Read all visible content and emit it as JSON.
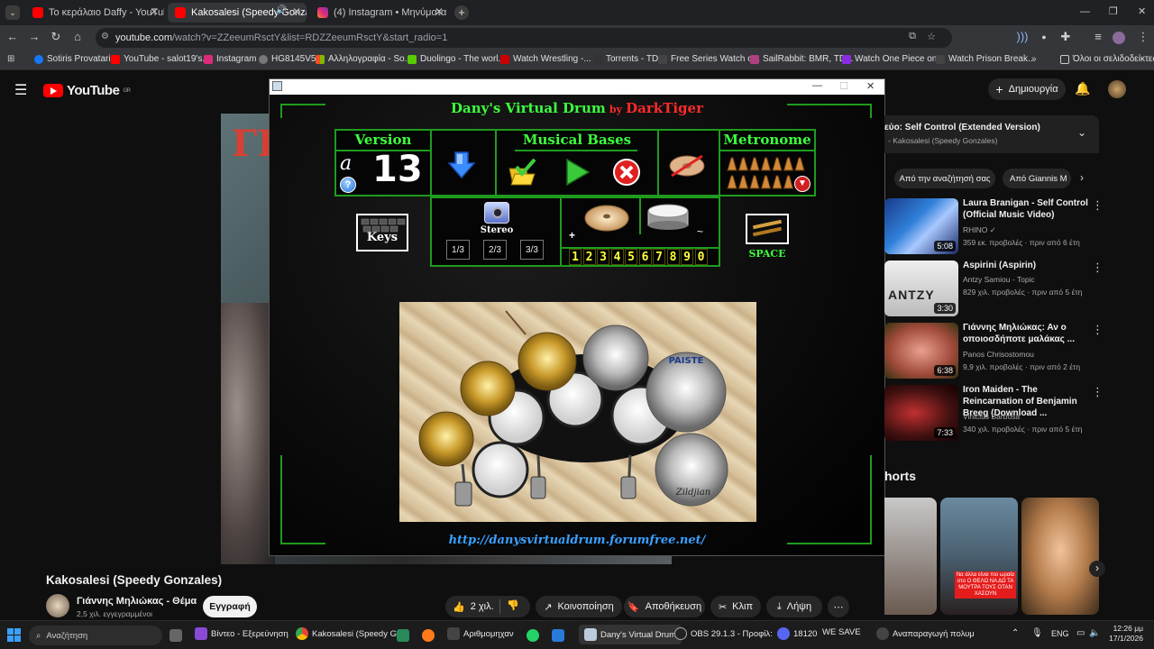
{
  "tabs": [
    {
      "label": "Το κεράλαιο Daffy - YouTube"
    },
    {
      "label": "Kakosalesi (Speedy Gonzales"
    },
    {
      "label": "(4) Instagram • Μηνύματα"
    }
  ],
  "address": {
    "host": "youtube.com",
    "path": "/watch?v=ZZeeumRsctY&list=RDZZeeumRsctY&start_radio=1"
  },
  "bookmarks": [
    "Sotiris Provataris",
    "YouTube - salot19's...",
    "Instagram",
    "HG8145V5",
    "Αλληλογραφία - So...",
    "Duolingo - The worl...",
    "Watch Wrestling -...",
    "Torrents - TD",
    "Free Series Watch o...",
    "SailRabbit: BMR, TD...",
    "Watch One Piece on...",
    "Watch Prison Break...",
    "Όλοι οι σελιδοδείκτες"
  ],
  "yt": {
    "logo": "YouTube",
    "region": "GR",
    "create_label": "Δημιουργία",
    "playlist_now": "εύο: Self Control (Extended Version)",
    "playlist_channel": "- Kakosalesi (Speedy Gonzales)",
    "chips": [
      "Από την αναζήτησή σας",
      "Από Giannis M"
    ],
    "video_title": "Kakosalesi (Speedy Gonzales)",
    "channel": "Γιάννης Μηλιώκας - Θέμα",
    "subs": "2,5 χιλ. εγγεγραμμένοι",
    "subscribe": "Εγγραφή",
    "likes": "2 χιλ.",
    "actions": [
      "Κοινοποίηση",
      "Αποθήκευση",
      "Κλιπ",
      "Λήψη"
    ],
    "shorts_label": "horts",
    "recommended": [
      {
        "title": "Laura Branigan - Self Control (Official Music Video)",
        "channel": "RHINO",
        "meta": "359 εκ. προβολές · πριν από 6 έτη",
        "duration": "5:08"
      },
      {
        "title": "Aspirini (Aspirin)",
        "channel": "Antzy Samiou - Topic",
        "meta": "829 χιλ. προβολές · πριν από 5 έτη",
        "duration": "3:30"
      },
      {
        "title": "Γιάννης Μηλιώκας: Αν ο οποιοσδήποτε μαλάκας ...",
        "channel": "Panos Chrisostomou",
        "meta": "9,9 χιλ. προβολές · πριν από 2 έτη",
        "duration": "6:38"
      },
      {
        "title": "Iron Maiden - The Reincarnation of Benjamin Breeg (Download ...",
        "channel": "Vinicius Barbosa",
        "meta": "340 χιλ. προβολές · πριν από 5 έτη",
        "duration": "7:33"
      }
    ],
    "thumb_text": "ANTZY",
    "short_caption": "Να άλλα είναι πιο ωραία στο Ο ΘΕΛΩ ΝΑ ΔΩ ΤΑ ΜΟΥΤΡΑ ΤΟΥΣ ΟΤΑΝ ΧΑΣΟΥΝ"
  },
  "drum": {
    "title": "Dany's Virtual Drum",
    "by": "by",
    "author": "DarkTiger",
    "version_label": "Version",
    "version_letter": "a",
    "version_number": "13",
    "bases_label": "Musical Bases",
    "metronome_label": "Metronome",
    "keys_label": "Keys",
    "stereo_label": "Stereo",
    "ratios": [
      "1/3",
      "2/3",
      "3/3"
    ],
    "numbers": [
      "1",
      "2",
      "3",
      "4",
      "5",
      "6",
      "7",
      "8",
      "9",
      "0"
    ],
    "plus": "+",
    "tilde": "~",
    "space_label": "SPACE",
    "url": "http://danysvirtualdrum.forumfree.net/",
    "cymbal_brands": [
      "PAISTE",
      "Zildjian"
    ]
  },
  "taskbar": {
    "search": "Αναζήτηση",
    "items": [
      "Βίντεο - Εξερεύνηση",
      "Kakosalesi (Speedy G",
      "Αριθμομηχαν",
      "Dany's Virtual Drum",
      "OBS 29.1.3 - Προφίλ:",
      "18120",
      "WE SAVE",
      "Αναπαραγωγή πολυμ"
    ],
    "lang": "ENG",
    "time": "12:26 μμ",
    "date": "17/1/2026"
  },
  "colors": {
    "accent_green": "#3dff3d",
    "border_green": "#1f9b1f",
    "yt_red": "#ff0000",
    "author_red": "#ff2a2a",
    "key_yellow": "#ffff3a"
  }
}
